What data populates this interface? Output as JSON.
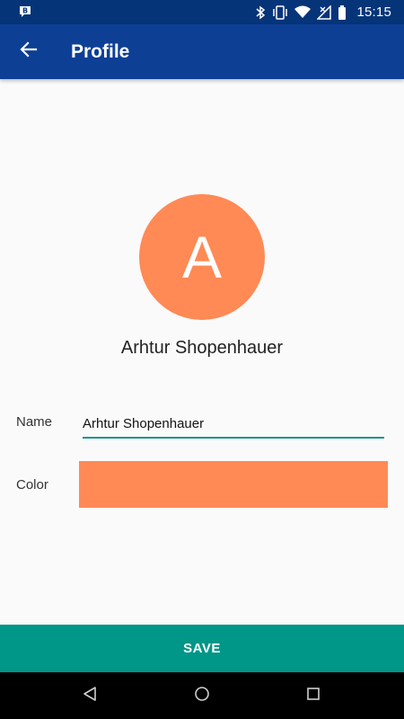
{
  "status_bar": {
    "time": "15:15",
    "icons": [
      "notification-icon",
      "bluetooth-icon",
      "vibrate-icon",
      "wifi-icon",
      "signal-icon",
      "battery-icon"
    ]
  },
  "app_bar": {
    "title": "Profile",
    "back_icon": "arrow-back-icon"
  },
  "profile": {
    "avatar_letter": "A",
    "display_name": "Arhtur Shopenhauer",
    "avatar_color": "#ff8a55"
  },
  "form": {
    "name_label": "Name",
    "name_value": "Arhtur Shopenhauer",
    "color_label": "Color",
    "color_value": "#ff8a55"
  },
  "actions": {
    "save_label": "SAVE"
  },
  "nav_bar": {
    "icons": [
      "nav-back-icon",
      "nav-home-icon",
      "nav-recents-icon"
    ]
  },
  "colors": {
    "status_bar": "#063478",
    "app_bar": "#0d3f95",
    "accent": "#009688",
    "input_underline": "#14968a",
    "swatch": "#ff8a55"
  }
}
